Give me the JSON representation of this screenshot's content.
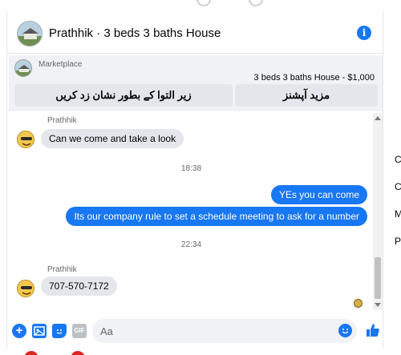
{
  "header": {
    "title": "Prathhik · 3 beds 3 baths House"
  },
  "marketplace": {
    "label": "Marketplace",
    "listing": "3 beds 3 baths House - $1,000",
    "btn_left": "زیر التوا کے بطور نشان زد کریں",
    "btn_right": "مزید آپشنز"
  },
  "messages": {
    "sender1": "Prathhik",
    "msg1": "Can we come and take a look",
    "time1": "18:38",
    "msg2": "YEs you can come",
    "msg3": "Its our company rule to set a schedule meeting to ask for a number",
    "time2": "22:34",
    "sender2": "Prathhik",
    "msg4": "707-570-7172"
  },
  "composer": {
    "placeholder": "Aa",
    "gif_label": "GIF"
  },
  "right_column": [
    "C",
    "C",
    "M",
    "P"
  ],
  "colors": {
    "accent": "#1877f2",
    "bubble_in": "#e4e6eb",
    "text_secondary": "#65676b"
  },
  "icons": [
    "info-icon",
    "plus-icon",
    "photo-icon",
    "sticker-icon",
    "gif-icon",
    "emoji-icon",
    "like-icon"
  ]
}
